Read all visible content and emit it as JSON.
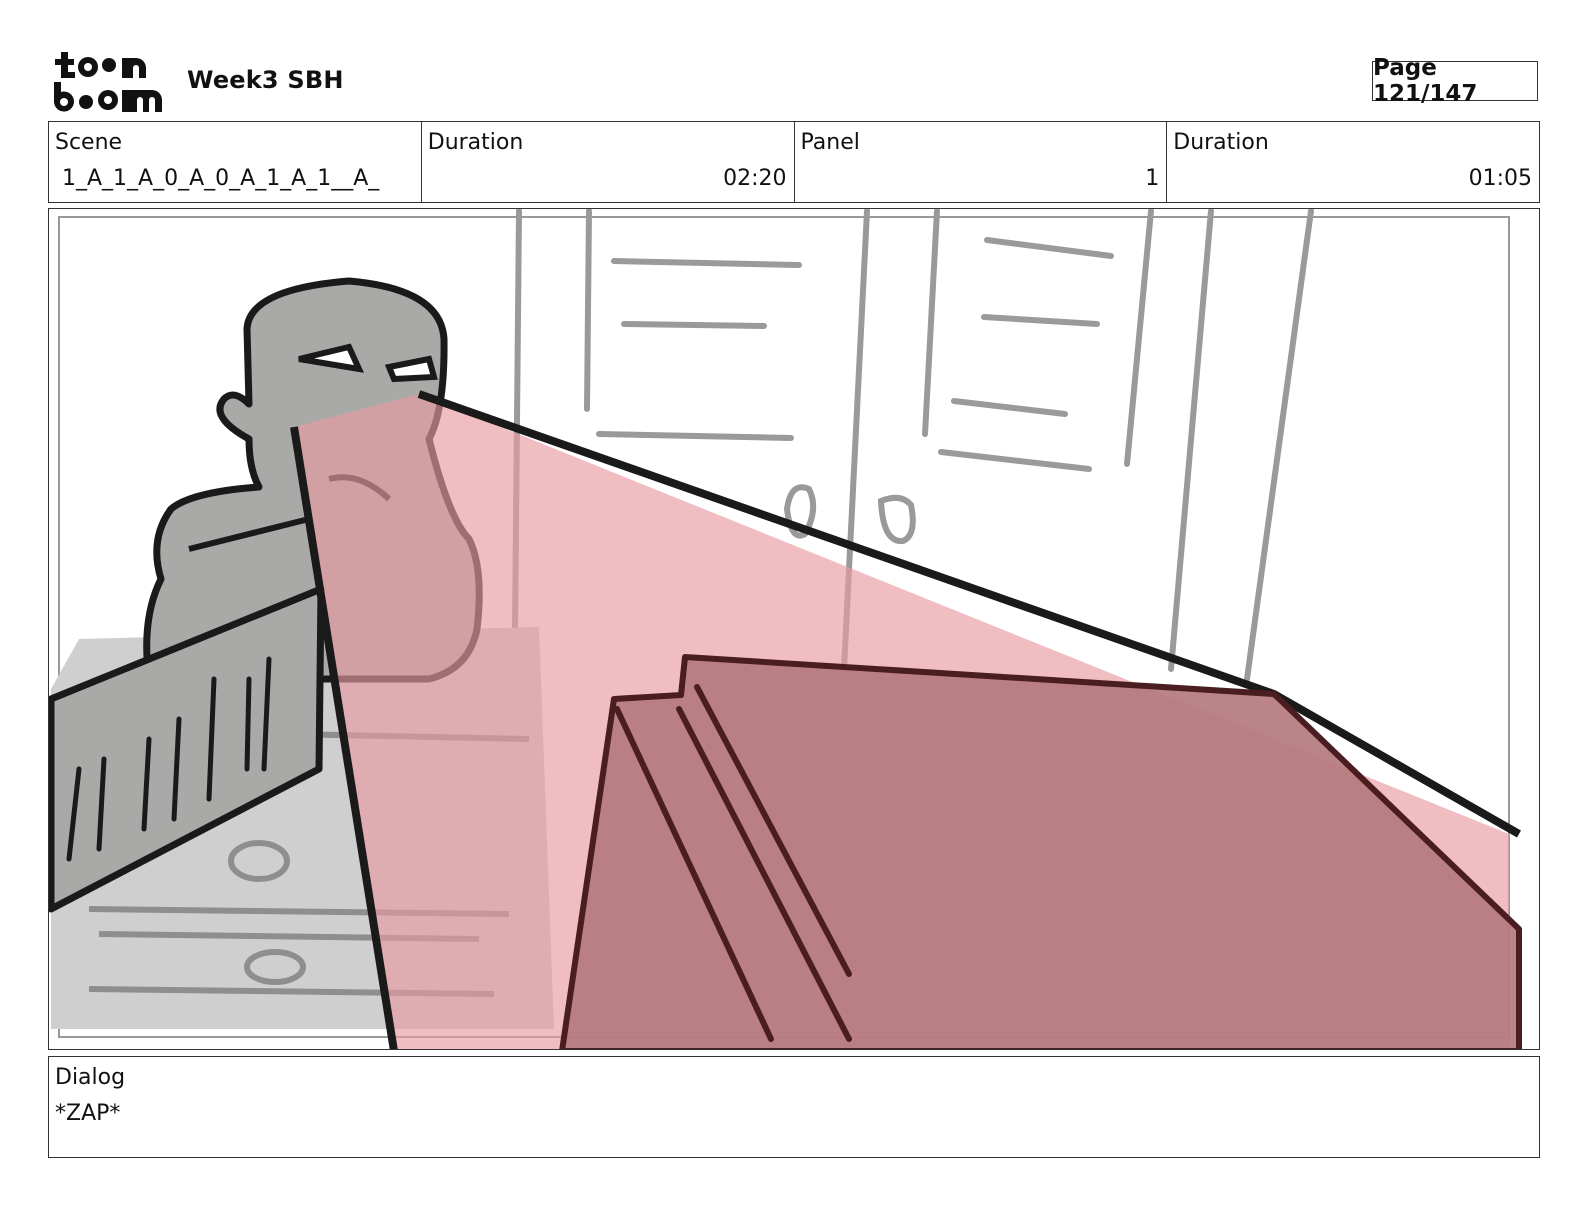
{
  "header": {
    "logo_text": "toon boom",
    "project_title": "Week3 SBH",
    "page_label": "Page 121/147"
  },
  "info": {
    "scene_label": "Scene",
    "scene_value": "1_A_1_A_0_A_0_A_1_A_1__A_",
    "scene_duration_label": "Duration",
    "scene_duration_value": "02:20",
    "panel_label": "Panel",
    "panel_value": "1",
    "panel_duration_label": "Duration",
    "panel_duration_value": "01:05"
  },
  "dialog": {
    "label": "Dialog",
    "text": "*ZAP*"
  },
  "colors": {
    "beam_fill": "#f0b8bd",
    "beam_dark": "#a6676b",
    "ink": "#1a1a1a",
    "character_grey": "#a9aaa7",
    "background_line": "#9a9a9a"
  }
}
